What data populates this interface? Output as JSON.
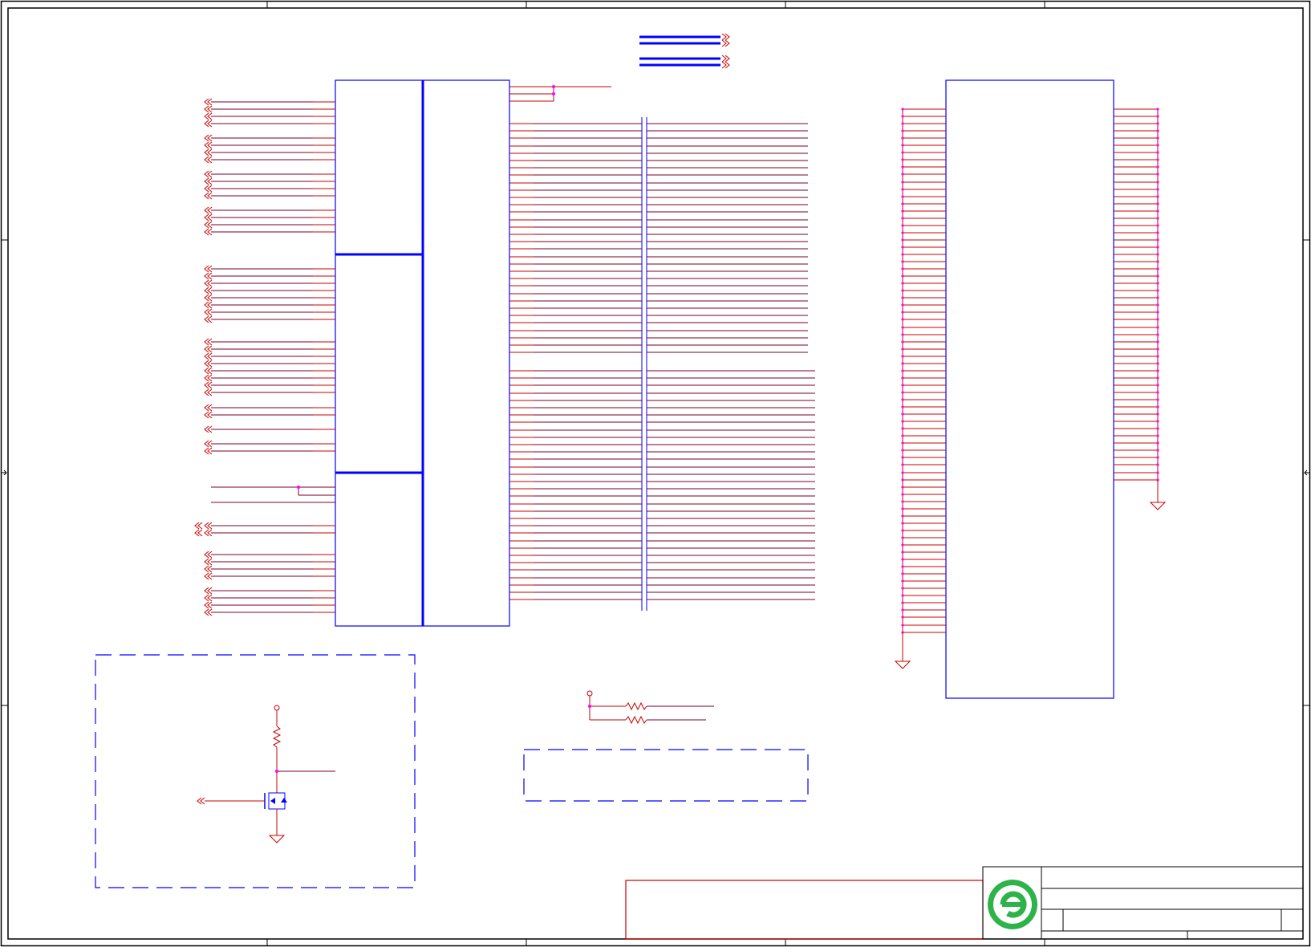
{
  "sheet": {
    "title": "",
    "colors": {
      "frame": "#000000",
      "wire": "#cc0000",
      "net": "#7a0026",
      "component": "#0000ff",
      "junction": "#ff00ff",
      "logo_green": "#2db34a"
    }
  },
  "icons": {
    "logo": "company-logo-e-circle",
    "ground": "ground-symbol",
    "resistor": "resistor-symbol",
    "mosfet": "mosfet-symbol",
    "offpage": "offpage-connector-chevron"
  }
}
